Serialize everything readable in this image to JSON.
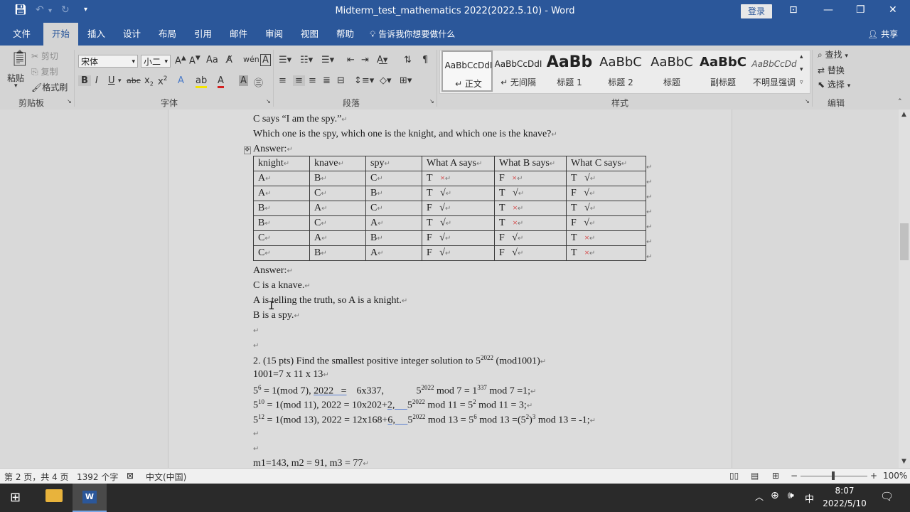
{
  "window": {
    "title": "Midterm_test_mathematics 2022(2022.5.10)  -  Word",
    "login": "登录"
  },
  "tabs": [
    "文件",
    "开始",
    "插入",
    "设计",
    "布局",
    "引用",
    "邮件",
    "审阅",
    "视图",
    "帮助"
  ],
  "tell_me": "告诉我你想要做什么",
  "share": "共享",
  "ribbon": {
    "clipboard": {
      "paste": "粘贴",
      "cut": "剪切",
      "copy": "复制",
      "format_painter": "格式刷",
      "label": "剪贴板"
    },
    "font": {
      "name": "宋体",
      "size": "小二",
      "label": "字体"
    },
    "paragraph": {
      "label": "段落"
    },
    "styles": {
      "label": "样式",
      "items": [
        {
          "preview": "AaBbCcDdI",
          "name": "↵ 正文"
        },
        {
          "preview": "AaBbCcDdI",
          "name": "↵ 无间隔"
        },
        {
          "preview": "AaBb",
          "name": "标题 1"
        },
        {
          "preview": "AaBbC",
          "name": "标题 2"
        },
        {
          "preview": "AaBbC",
          "name": "标题"
        },
        {
          "preview": "AaBbC",
          "name": "副标题"
        },
        {
          "preview": "AaBbCcDd",
          "name": "不明显强调"
        }
      ]
    },
    "editing": {
      "find": "查找",
      "replace": "替换",
      "select": "选择",
      "label": "编辑"
    }
  },
  "document": {
    "line1": "C says “I am the spy.”",
    "line2": "Which one is the spy, which one is the knight, and which one is the knave?",
    "answer_label": "Answer:",
    "table": {
      "headers": [
        "knight",
        "knave",
        "spy",
        "What A says",
        "What B says",
        "What C says"
      ],
      "rows": [
        [
          {
            "t": "A"
          },
          {
            "t": "B"
          },
          {
            "t": "C"
          },
          {
            "t": "T",
            "m": "×"
          },
          {
            "t": "F",
            "m": "×"
          },
          {
            "t": "T",
            "m": "√"
          }
        ],
        [
          {
            "t": "A"
          },
          {
            "t": "C"
          },
          {
            "t": "B"
          },
          {
            "t": "T",
            "m": "√"
          },
          {
            "t": "T",
            "m": "√"
          },
          {
            "t": "F",
            "m": "√"
          }
        ],
        [
          {
            "t": "B"
          },
          {
            "t": "A"
          },
          {
            "t": "C"
          },
          {
            "t": "F",
            "m": "√"
          },
          {
            "t": "T",
            "m": "×"
          },
          {
            "t": "T",
            "m": "√"
          }
        ],
        [
          {
            "t": "B"
          },
          {
            "t": "C"
          },
          {
            "t": "A"
          },
          {
            "t": "T",
            "m": "√"
          },
          {
            "t": "T",
            "m": "×"
          },
          {
            "t": "F",
            "m": "√"
          }
        ],
        [
          {
            "t": "C"
          },
          {
            "t": "A"
          },
          {
            "t": "B"
          },
          {
            "t": "F",
            "m": "√"
          },
          {
            "t": "F",
            "m": "√"
          },
          {
            "t": "T",
            "m": "×"
          }
        ],
        [
          {
            "t": "C"
          },
          {
            "t": "B"
          },
          {
            "t": "A"
          },
          {
            "t": "F",
            "m": "√"
          },
          {
            "t": "F",
            "m": "√"
          },
          {
            "t": "T",
            "m": "×"
          }
        ]
      ]
    },
    "answer2_label": "Answer:",
    "ans1": "C is a knave.",
    "ans2": "A is telling the truth, so A is a knight.",
    "ans3": "B is a spy.",
    "q2": "2. (15 pts) Find the smallest positive integer solution to 5",
    "q2_exp": "2022",
    "q2_tail": " (mod1001)",
    "fact": "1001=7 x 11 x 13",
    "m1": "m1=143,    m2 = 91,        m3 = 77"
  },
  "status": {
    "page": "第 2 页，共 4 页",
    "words": "1392 个字",
    "lang": "中文(中国)",
    "zoom": "100%"
  },
  "taskbar": {
    "ime": "中",
    "time": "8:07",
    "date": "2022/5/10"
  }
}
